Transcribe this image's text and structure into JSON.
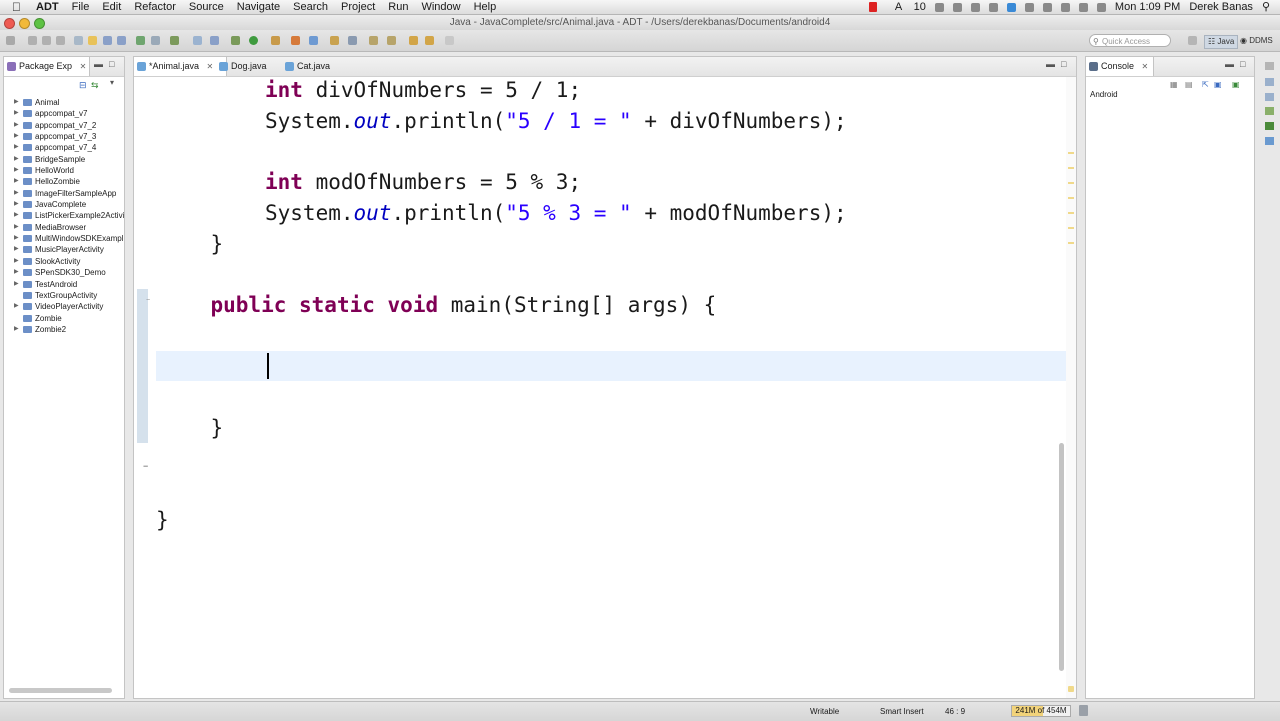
{
  "menubar": {
    "app_name": "ADT",
    "items": [
      "File",
      "Edit",
      "Refactor",
      "Source",
      "Navigate",
      "Search",
      "Project",
      "Run",
      "Window",
      "Help"
    ],
    "tray_counter": "10",
    "clock": "Mon 1:09 PM",
    "user": "Derek Banas"
  },
  "window": {
    "title": "Java - JavaComplete/src/Animal.java - ADT - /Users/derekbanas/Documents/android4"
  },
  "toolbar": {
    "quick_access_placeholder": "Quick Access",
    "perspective_java": "Java",
    "perspective_ddms": "DDMS"
  },
  "package_explorer": {
    "title": "Package Exp",
    "items": [
      {
        "label": "Animal",
        "expandable": true
      },
      {
        "label": "appcompat_v7",
        "expandable": true
      },
      {
        "label": "appcompat_v7_2",
        "expandable": true
      },
      {
        "label": "appcompat_v7_3",
        "expandable": true
      },
      {
        "label": "appcompat_v7_4",
        "expandable": true
      },
      {
        "label": "BridgeSample",
        "expandable": true
      },
      {
        "label": "HelloWorld",
        "expandable": true
      },
      {
        "label": "HelloZombie",
        "expandable": true
      },
      {
        "label": "ImageFilterSampleApp",
        "expandable": true
      },
      {
        "label": "JavaComplete",
        "expandable": true
      },
      {
        "label": "ListPickerExample2Activi",
        "expandable": true
      },
      {
        "label": "MediaBrowser",
        "expandable": true
      },
      {
        "label": "MultiWindowSDKExampl",
        "expandable": true
      },
      {
        "label": "MusicPlayerActivity",
        "expandable": true
      },
      {
        "label": "SlookActivity",
        "expandable": true
      },
      {
        "label": "SPenSDK30_Demo",
        "expandable": true
      },
      {
        "label": "TestAndroid",
        "expandable": true
      },
      {
        "label": "TextGroupActivity",
        "expandable": false
      },
      {
        "label": "VideoPlayerActivity",
        "expandable": true
      },
      {
        "label": "Zombie",
        "expandable": false
      },
      {
        "label": "Zombie2",
        "expandable": true
      }
    ]
  },
  "editor": {
    "tabs": [
      {
        "label": "*Animal.java",
        "active": true
      },
      {
        "label": "Dog.java",
        "active": false
      },
      {
        "label": "Cat.java",
        "active": false
      }
    ],
    "lines": [
      {
        "indent": 2,
        "tokens": [
          {
            "t": "int",
            "c": "kw"
          },
          {
            "t": " divOfNumbers = 5 / 1;"
          }
        ]
      },
      {
        "indent": 2,
        "tokens": [
          {
            "t": "System."
          },
          {
            "t": "out",
            "c": "fld"
          },
          {
            "t": ".println("
          },
          {
            "t": "\"5 / 1 = \"",
            "c": "str"
          },
          {
            "t": " + divOfNumbers);"
          }
        ]
      },
      {
        "indent": 0,
        "tokens": []
      },
      {
        "indent": 2,
        "tokens": [
          {
            "t": "int",
            "c": "kw"
          },
          {
            "t": " modOfNumbers = 5 % 3;"
          }
        ]
      },
      {
        "indent": 2,
        "tokens": [
          {
            "t": "System."
          },
          {
            "t": "out",
            "c": "fld"
          },
          {
            "t": ".println("
          },
          {
            "t": "\"5 % 3 = \"",
            "c": "str"
          },
          {
            "t": " + modOfNumbers);"
          }
        ]
      },
      {
        "indent": 1,
        "tokens": [
          {
            "t": "}"
          }
        ]
      },
      {
        "indent": 0,
        "tokens": []
      },
      {
        "indent": 1,
        "tokens": [
          {
            "t": "public",
            "c": "kw"
          },
          {
            "t": " "
          },
          {
            "t": "static",
            "c": "kw"
          },
          {
            "t": " "
          },
          {
            "t": "void",
            "c": "kw"
          },
          {
            "t": " main(String[] args) {"
          }
        ]
      },
      {
        "indent": 0,
        "tokens": []
      },
      {
        "indent": 2,
        "tokens": [],
        "current": true
      },
      {
        "indent": 0,
        "tokens": []
      },
      {
        "indent": 1,
        "tokens": [
          {
            "t": "}"
          }
        ]
      },
      {
        "indent": 0,
        "tokens": []
      },
      {
        "indent": 0,
        "tokens": []
      },
      {
        "indent": 0,
        "tokens": [
          {
            "t": "}"
          }
        ]
      }
    ]
  },
  "console": {
    "title": "Console",
    "content": "Android"
  },
  "statusbar": {
    "writable": "Writable",
    "insert_mode": "Smart Insert",
    "cursor_position": "46 : 9",
    "heap_label": "241M of 454M",
    "heap_fraction": 0.53
  },
  "colors": {
    "keyword": "#7f0055",
    "string": "#2a00ff",
    "field": "#0000c0",
    "current_line": "#e8f2fe"
  }
}
